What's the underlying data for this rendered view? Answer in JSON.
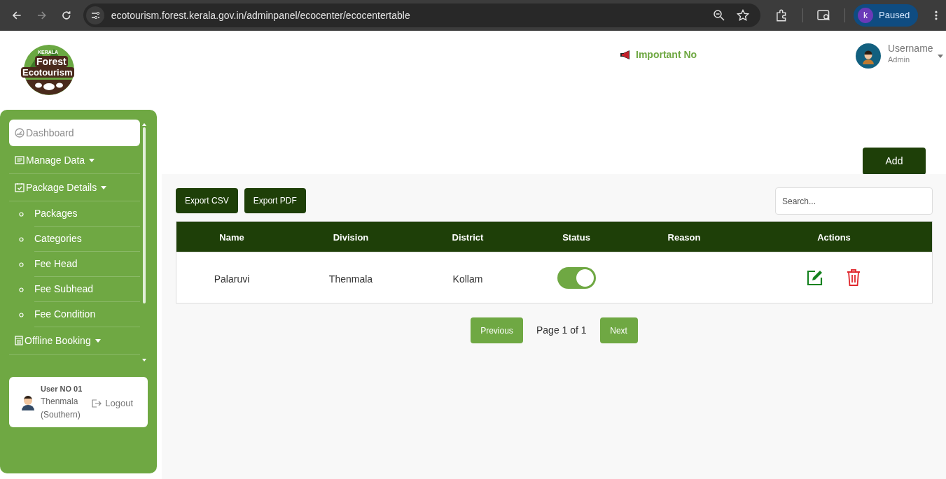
{
  "browser": {
    "url": "ecotourism.forest.kerala.gov.in/adminpanel/ecocenter/ecocentertable",
    "profile_initial": "k",
    "profile_label": "Paused"
  },
  "header": {
    "logo": {
      "top": "KERALA",
      "line1": "Forest",
      "line2": "Ecotourism"
    },
    "important_label": "Important No",
    "user": {
      "name": "Username",
      "role": "Admin"
    }
  },
  "sidebar": {
    "items": [
      {
        "label": "Dashboard",
        "kind": "main",
        "caret": false,
        "selected": true
      },
      {
        "label": "Manage Data",
        "kind": "main",
        "caret": true,
        "selected": false
      },
      {
        "label": "Package Details",
        "kind": "main",
        "caret": true,
        "selected": false
      },
      {
        "label": "Packages",
        "kind": "sub",
        "selected": false
      },
      {
        "label": "Categories",
        "kind": "sub",
        "selected": false
      },
      {
        "label": "Fee Head",
        "kind": "sub",
        "selected": false
      },
      {
        "label": "Fee Subhead",
        "kind": "sub",
        "selected": false
      },
      {
        "label": "Fee Condition",
        "kind": "sub",
        "selected": false
      },
      {
        "label": "Offline Booking",
        "kind": "main",
        "caret": true,
        "selected": false
      }
    ],
    "user_card": {
      "user_id": "User NO 01",
      "location_lines": [
        "Thenmala",
        "(Southern)"
      ],
      "logout": "Logout"
    }
  },
  "main": {
    "add_button": "Add",
    "export_buttons": [
      "Export CSV",
      "Export PDF"
    ],
    "search": {
      "placeholder": "Search..."
    },
    "table": {
      "columns": [
        "Name",
        "Division",
        "District",
        "Status",
        "Reason",
        "Actions"
      ],
      "rows": [
        {
          "name": "Palaruvi",
          "division": "Thenmala",
          "district": "Kollam",
          "status_on": true
        }
      ]
    },
    "pagination": {
      "previous": "Previous",
      "page": "Page 1 of 1",
      "next": "Next"
    }
  }
}
